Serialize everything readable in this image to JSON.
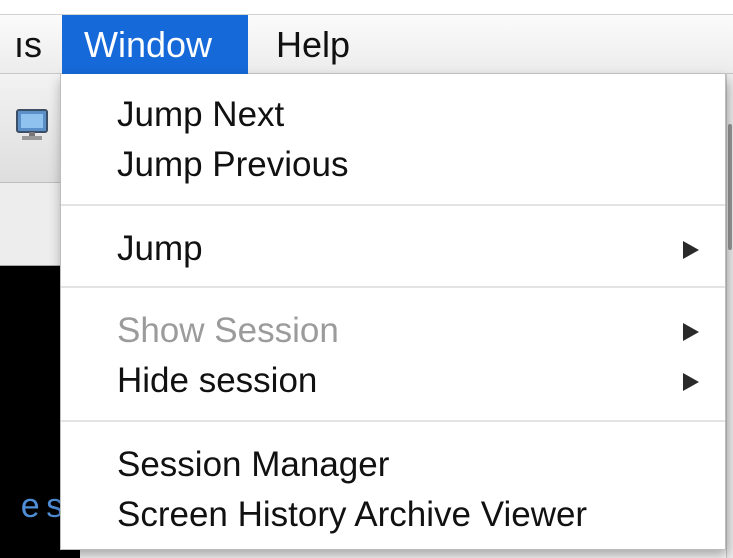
{
  "menubar": {
    "prev_menu_fragment": "ıs",
    "active_menu": "Window",
    "next_menu": "Help"
  },
  "background_app": {
    "terminal_text": "es"
  },
  "window_menu": {
    "items": [
      {
        "label": "Jump Next",
        "enabled": true,
        "submenu": false
      },
      {
        "label": "Jump Previous",
        "enabled": true,
        "submenu": false
      },
      {
        "label": "Jump",
        "enabled": true,
        "submenu": true
      },
      {
        "label": "Show Session",
        "enabled": false,
        "submenu": true
      },
      {
        "label": "Hide session",
        "enabled": true,
        "submenu": true
      },
      {
        "label": "Session Manager",
        "enabled": true,
        "submenu": false
      },
      {
        "label": "Screen History Archive Viewer",
        "enabled": true,
        "submenu": false
      }
    ]
  },
  "colors": {
    "menu_highlight": "#1669d8",
    "disabled_text": "#9b9b9b",
    "terminal_bg": "#000000",
    "terminal_text": "#4f8fd8"
  },
  "icons": {
    "submenu_indicator": "chevron-right-icon",
    "toolbar_monitor": "monitor-icon",
    "toolbar_tools": "tools-icon"
  }
}
